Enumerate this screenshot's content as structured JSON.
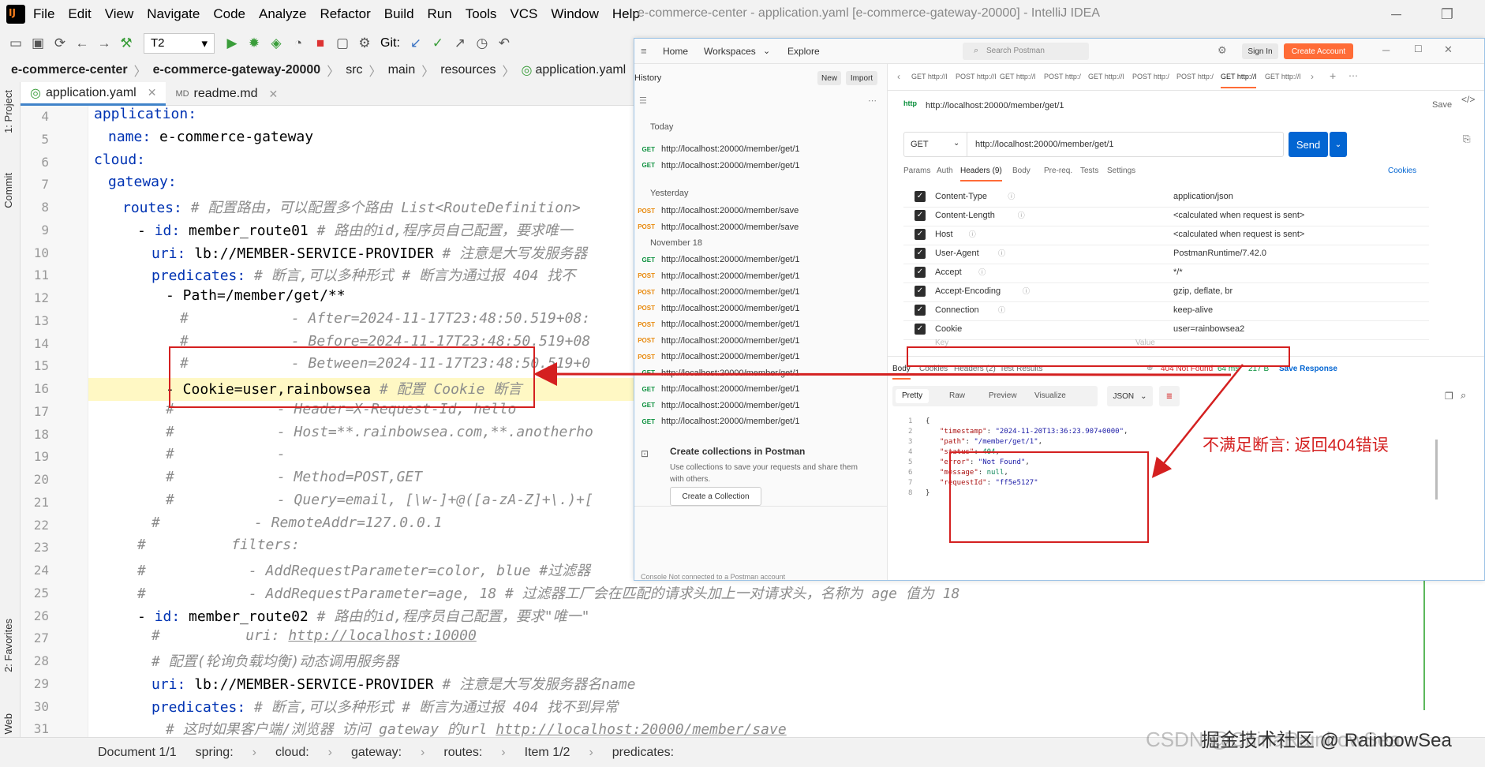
{
  "menu": {
    "items": [
      "File",
      "Edit",
      "View",
      "Navigate",
      "Code",
      "Analyze",
      "Refactor",
      "Build",
      "Run",
      "Tools",
      "VCS",
      "Window",
      "Help"
    ],
    "window_title": "e-commerce-center - application.yaml [e-commerce-gateway-20000] - IntelliJ IDEA"
  },
  "toolbar": {
    "run_config": "T2",
    "git_label": "Git:"
  },
  "breadcrumbs": [
    "e-commerce-center",
    "e-commerce-gateway-20000",
    "src",
    "main",
    "resources",
    "application.yaml"
  ],
  "side": {
    "project": "1: Project",
    "commit": "Commit",
    "favorites": "2: Favorites",
    "web": "Web"
  },
  "tabs": [
    {
      "label": "application.yaml"
    },
    {
      "label": "readme.md"
    }
  ],
  "line_numbers": [
    "4",
    "5",
    "6",
    "7",
    "8",
    "9",
    "10",
    "11",
    "12",
    "13",
    "14",
    "15",
    "16",
    "17",
    "18",
    "19",
    "20",
    "21",
    "22",
    "23",
    "24",
    "25",
    "26",
    "27",
    "28",
    "29",
    "30",
    "31"
  ],
  "code": {
    "l4": "application:",
    "l5a": "name:",
    "l5b": " e-commerce-gateway",
    "l6": "cloud:",
    "l7": "gateway:",
    "l8a": "routes:",
    "l8b": " # 配置路由，可以配置多个路由 List<RouteDefinition>",
    "l9a": "- ",
    "l9b": "id:",
    "l9c": " member_route01 ",
    "l9d": "# 路由的id,程序员自己配置，要求唯一",
    "l10a": "uri:",
    "l10b": " lb://MEMBER-SERVICE-PROVIDER ",
    "l10c": "# 注意是大写发服务器",
    "l11a": "predicates:",
    "l11b": " # 断言,可以多种形式 # 断言为通过报 404 找不",
    "l12": "- Path=/member/get/**",
    "l13": "#            - After=2024-11-17T23:48:50.519+08:",
    "l14": "#            - Before=2024-11-17T23:48:50.519+08",
    "l15": "#            - Between=2024-11-17T23:48:50.519+0",
    "l16a": "- Cookie=user,rainbowsea ",
    "l16b": "# 配置 Cookie 断言",
    "l17": "#            - Header=X-Request-Id, hello",
    "l18": "#            - Host=**.rainbowsea.com,**.anotherho",
    "l19": "#            -",
    "l20": "#            - Method=POST,GET",
    "l21": "#            - Query=email, [\\w-]+@([a-zA-Z]+\\.)+[",
    "l22": "#           - RemoteAddr=127.0.0.1",
    "l23": "#          filters:",
    "l24": "#            - AddRequestParameter=color, blue #过滤器",
    "l25": "#            - AddRequestParameter=age, 18 # 过滤器工厂会在匹配的请求头加上一对请求头，名称为 age 值为 18",
    "l26a": "- ",
    "l26b": "id:",
    "l26c": " member_route02 ",
    "l26d": "# 路由的id,程序员自己配置，要求\"唯一\"",
    "l27a": "#          uri: ",
    "l27b": "http://localhost:10000",
    "l28": "# 配置(轮询负载均衡)动态调用服务器",
    "l29a": "uri:",
    "l29b": " lb://MEMBER-SERVICE-PROVIDER ",
    "l29c": "# 注意是大写发服务器名name",
    "l30a": "predicates:",
    "l30b": " # 断言,可以多种形式 # 断言为通过报 404 找不到异常",
    "l31a": "# 这时如果客户端/浏览器 访问 gateway 的url ",
    "l31b": "http://localhost:20000/member/save"
  },
  "statusbar": [
    "Document 1/1",
    "spring:",
    "cloud:",
    "gateway:",
    "routes:",
    "Item 1/2",
    "predicates:"
  ],
  "postman": {
    "nav": {
      "home": "Home",
      "workspaces": "Workspaces",
      "explore": "Explore",
      "search": "Search Postman",
      "signin": "Sign In",
      "create": "Create Account"
    },
    "history": {
      "title": "History",
      "new_btn": "New",
      "import_btn": "Import",
      "today": "Today",
      "yesterday": "Yesterday",
      "nov18": "November 18",
      "today_items": [
        {
          "m": "GET",
          "u": "http://localhost:20000/member/get/1"
        },
        {
          "m": "GET",
          "u": "http://localhost:20000/member/get/1"
        }
      ],
      "yesterday_items": [
        {
          "m": "POST",
          "u": "http://localhost:20000/member/save"
        },
        {
          "m": "POST",
          "u": "http://localhost:20000/member/save"
        }
      ],
      "nov18_items": [
        {
          "m": "GET",
          "u": "http://localhost:20000/member/get/1"
        },
        {
          "m": "POST",
          "u": "http://localhost:20000/member/get/1"
        },
        {
          "m": "POST",
          "u": "http://localhost:20000/member/get/1"
        },
        {
          "m": "POST",
          "u": "http://localhost:20000/member/get/1"
        },
        {
          "m": "POST",
          "u": "http://localhost:20000/member/get/1"
        },
        {
          "m": "POST",
          "u": "http://localhost:20000/member/get/1"
        },
        {
          "m": "POST",
          "u": "http://localhost:20000/member/get/1"
        },
        {
          "m": "GET",
          "u": "http://localhost:20000/member/get/1"
        },
        {
          "m": "GET",
          "u": "http://localhost:20000/member/get/1"
        },
        {
          "m": "GET",
          "u": "http://localhost:20000/member/get/1"
        },
        {
          "m": "GET",
          "u": "http://localhost:20000/member/get/1"
        }
      ],
      "collections_title": "Create collections in Postman",
      "collections_desc": "Use collections to save your requests and share them with others.",
      "collections_btn": "Create a Collection"
    },
    "req_tabs": [
      "GET http://l",
      "POST http://l",
      "GET http://l",
      "POST http:/",
      "GET http://l",
      "POST http:/",
      "POST http:/",
      "GET http://l",
      "GET http://l"
    ],
    "request": {
      "title": "http://localhost:20000/member/get/1",
      "save": "Save",
      "method": "GET",
      "url": "http://localhost:20000/member/get/1",
      "send": "Send",
      "tabs": [
        "Params",
        "Auth",
        "Headers (9)",
        "Body",
        "Pre-req.",
        "Tests",
        "Settings"
      ],
      "cookies": "Cookies",
      "headers": [
        {
          "k": "Content-Type",
          "v": "application/json"
        },
        {
          "k": "Content-Length",
          "v": "<calculated when request is sent>"
        },
        {
          "k": "Host",
          "v": "<calculated when request is sent>"
        },
        {
          "k": "User-Agent",
          "v": "PostmanRuntime/7.42.0"
        },
        {
          "k": "Accept",
          "v": "*/*"
        },
        {
          "k": "Accept-Encoding",
          "v": "gzip, deflate, br"
        },
        {
          "k": "Connection",
          "v": "keep-alive"
        },
        {
          "k": "Cookie",
          "v": "user=rainbowsea2"
        }
      ],
      "key_ph": "Key",
      "value_ph": "Value"
    },
    "response": {
      "tabs": [
        "Body",
        "Cookies",
        "Headers (2)",
        "Test Results"
      ],
      "status": "404 Not Found",
      "time": "64 ms",
      "size": "217 B",
      "save": "Save Response",
      "views": [
        "Pretty",
        "Raw",
        "Preview",
        "Visualize"
      ],
      "format": "JSON",
      "json_lines": [
        {
          "n": "1",
          "t": "{"
        },
        {
          "n": "2",
          "k": "\"timestamp\"",
          "v": "\"2024-11-20T13:36:23.907+0000\"",
          "e": ","
        },
        {
          "n": "3",
          "k": "\"path\"",
          "v": "\"/member/get/1\"",
          "e": ","
        },
        {
          "n": "4",
          "k": "\"status\"",
          "v": "404",
          "e": ","
        },
        {
          "n": "5",
          "k": "\"error\"",
          "v": "\"Not Found\"",
          "e": ","
        },
        {
          "n": "6",
          "k": "\"message\"",
          "v": "null",
          "e": ","
        },
        {
          "n": "7",
          "k": "\"requestId\"",
          "v": "\"ff5e5127\"",
          "e": ""
        },
        {
          "n": "8",
          "t": "}"
        }
      ]
    },
    "footer": "Console   Not connected to a Postman account"
  },
  "annotation": "不满足断言: 返回404错误",
  "watermark": "掘金技术社区 @ RainbowSea",
  "watermark2": "CSDN @ChinaRainbowSea",
  "colors": {
    "annotation_red": "#d42020",
    "send_blue": "#0265d2",
    "create_orange": "#ff6c37"
  }
}
